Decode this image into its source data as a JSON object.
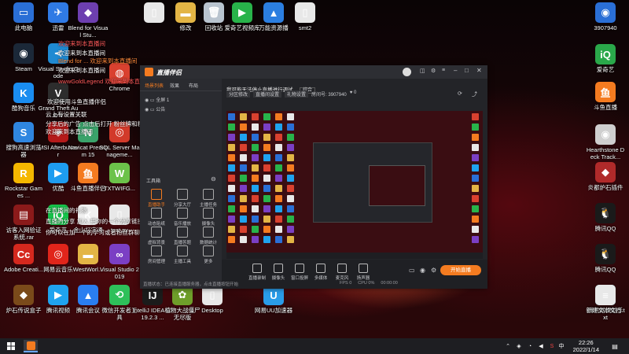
{
  "desktop_icons": [
    {
      "label": "此电脑",
      "color": "#2a6fd6",
      "glyph": "▭",
      "icon": "computer-icon"
    },
    {
      "label": "迅雷",
      "color": "#2f7ae5",
      "glyph": "✈",
      "icon": "thunder-icon"
    },
    {
      "label": "Blend for Visual Stu...",
      "color": "#6d3fb0",
      "glyph": "◆",
      "icon": "blend-icon"
    },
    {
      "label": "",
      "color": "#e8e8e8",
      "glyph": "▯",
      "icon": "file-icon"
    },
    {
      "label": "修改",
      "color": "#e3b545",
      "glyph": "▬",
      "icon": "folder-icon"
    },
    {
      "label": "回收站",
      "color": "#b9c4cf",
      "glyph": "🗑",
      "icon": "recycle-bin-icon"
    },
    {
      "label": "爱奇艺视频库",
      "color": "#28b34a",
      "glyph": "▶",
      "icon": "iqiyi-library-icon"
    },
    {
      "label": "万能资源播",
      "color": "#2b7ee0",
      "glyph": "▲",
      "icon": "player-icon"
    },
    {
      "label": "smt2",
      "color": "#e8e8e8",
      "glyph": "▯",
      "icon": "file-icon"
    },
    {
      "label": "Steam",
      "color": "#1b2838",
      "glyph": "◉",
      "icon": "steam-icon"
    },
    {
      "label": "Visual Studio Code",
      "color": "#1f8ad2",
      "glyph": "≺",
      "icon": "vscode-icon"
    },
    {
      "label": "Chrome",
      "color": "#d9412f",
      "glyph": "◍",
      "icon": "chrome-icon"
    },
    {
      "label": "酷狗音乐",
      "color": "#1a8df0",
      "glyph": "K",
      "icon": "kugou-icon"
    },
    {
      "label": "Grand Theft Auto V",
      "color": "#2d2d2d",
      "glyph": "V",
      "icon": "gta-icon"
    },
    {
      "label": "MSI Afterburner",
      "color": "#b41a1a",
      "glyph": "◈",
      "icon": "afterburner-icon"
    },
    {
      "label": "Navicat Premium 15",
      "color": "#3aa26a",
      "glyph": "N",
      "icon": "navicat-icon"
    },
    {
      "label": "SQL Server Manageme...",
      "color": "#d23a2a",
      "glyph": "◎",
      "icon": "sql-server-icon"
    },
    {
      "label": "搜狗高速浏览器",
      "color": "#2f86e0",
      "glyph": "S",
      "icon": "sogou-browser-icon"
    },
    {
      "label": "Rockstar Games ...",
      "color": "#f5b700",
      "glyph": "R",
      "icon": "rockstar-icon"
    },
    {
      "label": "优酷",
      "color": "#1e9cf0",
      "glyph": "▶",
      "icon": "youku-icon"
    },
    {
      "label": "斗鱼直播伴侣",
      "color": "#f47b20",
      "glyph": "鱼",
      "icon": "douyu-companion-icon"
    },
    {
      "label": "TXTWIFG...",
      "color": "#6cc24a",
      "glyph": "W",
      "icon": "txtwifg-icon"
    },
    {
      "label": "访客入网验证系统.rar",
      "color": "#8b1a1a",
      "glyph": "▤",
      "icon": "rar-icon"
    },
    {
      "label": "爱奇艺",
      "color": "#16c24a",
      "glyph": "iQ",
      "icon": "iqiyi-icon"
    },
    {
      "label": "金山打字通",
      "color": "#f0f0f0",
      "glyph": "K",
      "icon": "jinshan-icon"
    },
    {
      "label": "test.py",
      "color": "#e8e8e8",
      "glyph": "▯",
      "icon": "python-file-icon"
    },
    {
      "label": "Adobe Creati...",
      "color": "#d5281e",
      "glyph": "Cc",
      "icon": "adobe-cc-icon"
    },
    {
      "label": "网易云音乐",
      "color": "#e1251b",
      "glyph": "◎",
      "icon": "netease-music-icon"
    },
    {
      "label": "WestWorl...",
      "color": "#e3b545",
      "glyph": "▬",
      "icon": "folder-icon"
    },
    {
      "label": "Visual Studio 2019",
      "color": "#7b3fc4",
      "glyph": "∞",
      "icon": "vs2019-icon"
    },
    {
      "label": "炉石传说盒子",
      "color": "#7a4a1a",
      "glyph": "◆",
      "icon": "hearthstone-box-icon"
    },
    {
      "label": "腾讯视频",
      "color": "#1fa3ef",
      "glyph": "▶",
      "icon": "tencent-video-icon"
    },
    {
      "label": "腾讯会议",
      "color": "#2a7ef0",
      "glyph": "▲",
      "icon": "tencent-meeting-icon"
    },
    {
      "label": "微信开发者工具",
      "color": "#2ec05a",
      "glyph": "⟲",
      "icon": "wechat-devtools-icon"
    },
    {
      "label": "IntelliJ IDEA 2019.2.3 ...",
      "color": "#1b1b1b",
      "glyph": "IJ",
      "icon": "intellij-icon"
    },
    {
      "label": "植物大战僵尸无尽版",
      "color": "#6e9e2a",
      "glyph": "✿",
      "icon": "pvz-icon"
    },
    {
      "label": "Desktop",
      "color": "#e8e8e8",
      "glyph": "▯",
      "icon": "file-icon"
    },
    {
      "label": "网易UU加速器",
      "color": "#2a9ce8",
      "glyph": "U",
      "icon": "uu-icon"
    },
    {
      "label": "腾讯QQ",
      "color": "#1a1a1a",
      "glyph": "🐧",
      "icon": "qq-icon"
    },
    {
      "label": "爱奇艺",
      "color": "#2aa84a",
      "glyph": "iQ",
      "icon": "iqiyi-icon"
    },
    {
      "label": "斗鱼直播",
      "color": "#f47b20",
      "glyph": "鱼",
      "icon": "douyu-icon"
    },
    {
      "label": "Hearthstone Deck Track...",
      "color": "#cfcfcf",
      "glyph": "◉",
      "icon": "hdt-icon"
    },
    {
      "label": "炎都炉石插件",
      "color": "#b02a2a",
      "glyph": "◆",
      "icon": "plugin-icon"
    },
    {
      "label": "腾讯QQ",
      "color": "#1a1a1a",
      "glyph": "🐧",
      "icon": "qq-icon"
    },
    {
      "label": "腾讯网课助手",
      "color": "#1fb3c8",
      "glyph": "◇",
      "icon": "tencent-class-icon"
    },
    {
      "label": "新建文本文档.txt",
      "color": "#e8e8e8",
      "glyph": "≡",
      "icon": "text-file-icon"
    },
    {
      "label": "3907940",
      "color": "#2a6fd6",
      "glyph": "◉",
      "icon": "avatar-icon"
    }
  ],
  "chat_lines": [
    {
      "text": "欢迎来到本直播间",
      "color": "#ff5a5a"
    },
    {
      "text": "欢迎来到本直播间",
      "color": "#ffffff"
    },
    {
      "text": "Blend for ... 欢迎来到本直播间",
      "color": "#ff8a3a"
    },
    {
      "text": "欢迎来到本直播间",
      "color": "#ffffff"
    },
    {
      "text": "wwwGoldLegend 欢迎来到本直播间",
      "color": "#ff5a5a"
    },
    {
      "text": "欢迎使用斗鱼直播伴侣",
      "color": "#ffffff"
    },
    {
      "text": "云上有设置关联",
      "color": "#ffffff"
    },
    {
      "text": "分享后的广告 点击后打开 粉丝牌和粉丝等",
      "color": "#ffffff"
    },
    {
      "text": "欢迎来到本直播间",
      "color": "#ffffff"
    },
    {
      "text": "在直播间的礼物",
      "color": "#ffffff"
    },
    {
      "text": "直播的分享 加入 把你的一个分享链接",
      "color": "#ffffff"
    },
    {
      "text": "你可以在加一个的学习或者粉丝群聊",
      "color": "#ffffff"
    }
  ],
  "live_window": {
    "app_title": "直播伴侣",
    "side_tabs": [
      "场景列表",
      "效果",
      "布局"
    ],
    "scene_items": [
      "全屏 1",
      "公告"
    ],
    "tools_header": "工具箱",
    "tools": [
      "直播助手",
      "分享大厅",
      "主播任务",
      "动态贴纸",
      "音乐播放",
      "摄像头",
      "虚拟背景",
      "直播答题",
      "数据统计",
      "房间管理",
      "主播工具",
      "更多"
    ],
    "room_title": "我可能无法停止直播进行调试",
    "room_tag": "综合",
    "room_buttons": [
      "分区修改",
      "直播间设置",
      "礼物设置"
    ],
    "room_id": "3907940",
    "like_count": "0",
    "bottom_tools": [
      "直播录制",
      "摄像头",
      "窗口投屏",
      "多媒体",
      "麦克风",
      "扬声器"
    ],
    "start_button": "开始直播",
    "status_left": "直播状态：已连接直播服务器，点击直播按钮开始",
    "stats": [
      "FPS 0",
      "CPU 0%",
      "00:00:00"
    ]
  },
  "taskbar": {
    "pinned": [
      "windows-start",
      "search",
      "taskview",
      "douyu-companion"
    ],
    "time": "22:26",
    "date": "2022/1/14",
    "tray": [
      "chevron-up-icon",
      "network-icon",
      "volume-icon",
      "ime-icon",
      "notification-icon"
    ]
  }
}
